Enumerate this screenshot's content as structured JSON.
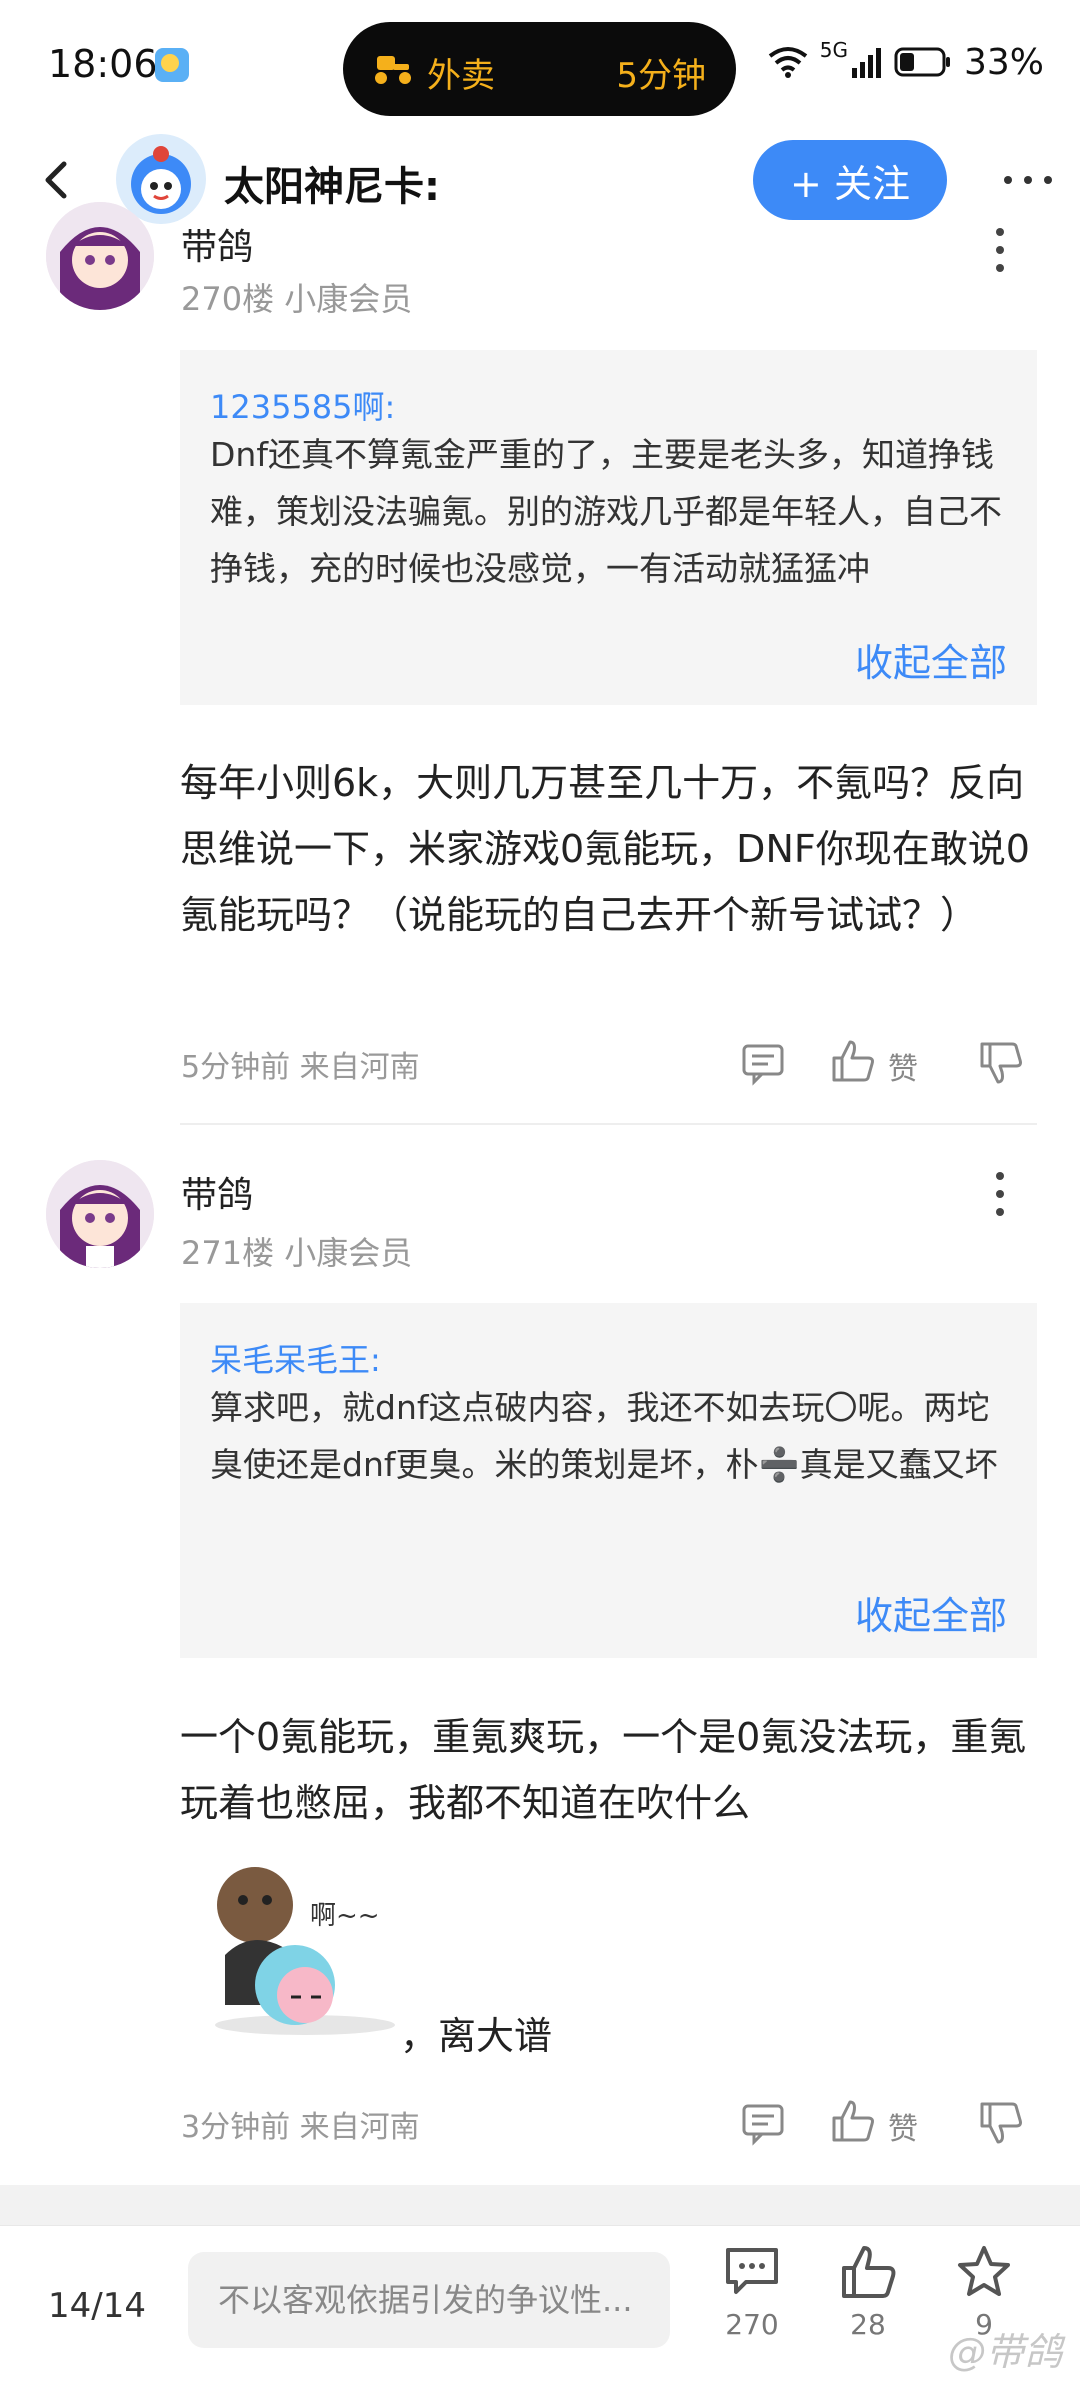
{
  "status_bar": {
    "time": "18:06",
    "island_app": "外卖",
    "island_eta": "5分钟",
    "network": "5G",
    "battery": "33%"
  },
  "header": {
    "title": "太阳神尼卡:",
    "follow_label": "+ 关注"
  },
  "posts": [
    {
      "name": "带鸽",
      "floor": "270楼 小康会员",
      "quote_name": "1235585啊:",
      "quote_text": "Dnf还真不算氪金严重的了，主要是老头多，知道挣钱难，策划没法骗氪。别的游戏几乎都是年轻人，自己不挣钱，充的时候也没感觉，一有活动就猛猛冲",
      "collapse_label": "收起全部",
      "reply_text": "每年小则6k，大则几万甚至几十万，不氪吗？反向思维说一下，米家游戏0氪能玩，DNF你现在敢说0氪能玩吗？（说能玩的自己去开个新号试试？）",
      "meta": "5分钟前 来自河南",
      "like_label": "赞"
    },
    {
      "name": "带鸽",
      "floor": "271楼 小康会员",
      "quote_name": "呆毛呆毛王:",
      "quote_text": "算求吧，就dnf这点破内容，我还不如去玩〇呢。两坨臭使还是dnf更臭。米的策划是坏，朴➗真是又蠢又坏",
      "collapse_label": "收起全部",
      "reply_text": "一个0氪能玩，重氪爽玩，一个是0氪没法玩，重氪玩着也憋屈，我都不知道在吹什么",
      "sticker_caption": "啊~~",
      "reply_tail": "，离大谱",
      "meta": "3分钟前 来自河南",
      "like_label": "赞"
    }
  ],
  "bottom_bar": {
    "page_indicator": "14/14",
    "input_placeholder": "不以客观依据引发的争议性...",
    "comment_count": "270",
    "like_count": "28",
    "star_count": "9"
  },
  "watermark": "@带鸽",
  "colors": {
    "accent": "#3d8af7",
    "island_text": "#f5b01b",
    "quote_bg": "#f5f5f5"
  }
}
